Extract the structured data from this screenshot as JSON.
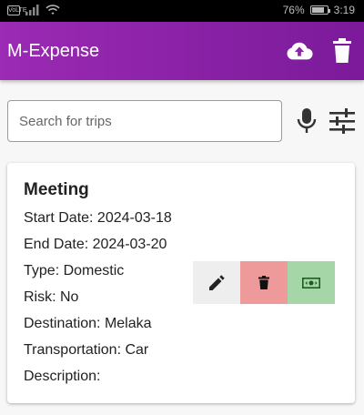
{
  "status": {
    "battery": "76%",
    "time": "3:19",
    "sim": "VoLTE"
  },
  "appbar": {
    "title": "M-Expense"
  },
  "search": {
    "placeholder": "Search for trips",
    "value": ""
  },
  "trip": {
    "name": "Meeting",
    "start_date": "Start Date: 2024-03-18",
    "end_date": "End Date: 2024-03-20",
    "type": "Type: Domestic",
    "risk": "Risk: No",
    "destination": "Destination: Melaka",
    "transportation": "Transportation: Car",
    "description": "Description:"
  },
  "colors": {
    "appbar": "#8e24aa",
    "delete_bg": "#ef9a9a",
    "expense_bg": "#a5d6a7",
    "edit_bg": "#eeeeee"
  },
  "icons": [
    "cloud-upload-icon",
    "trash-icon",
    "mic-icon",
    "filter-sliders-icon",
    "edit-pencil-icon",
    "delete-icon",
    "money-icon"
  ]
}
